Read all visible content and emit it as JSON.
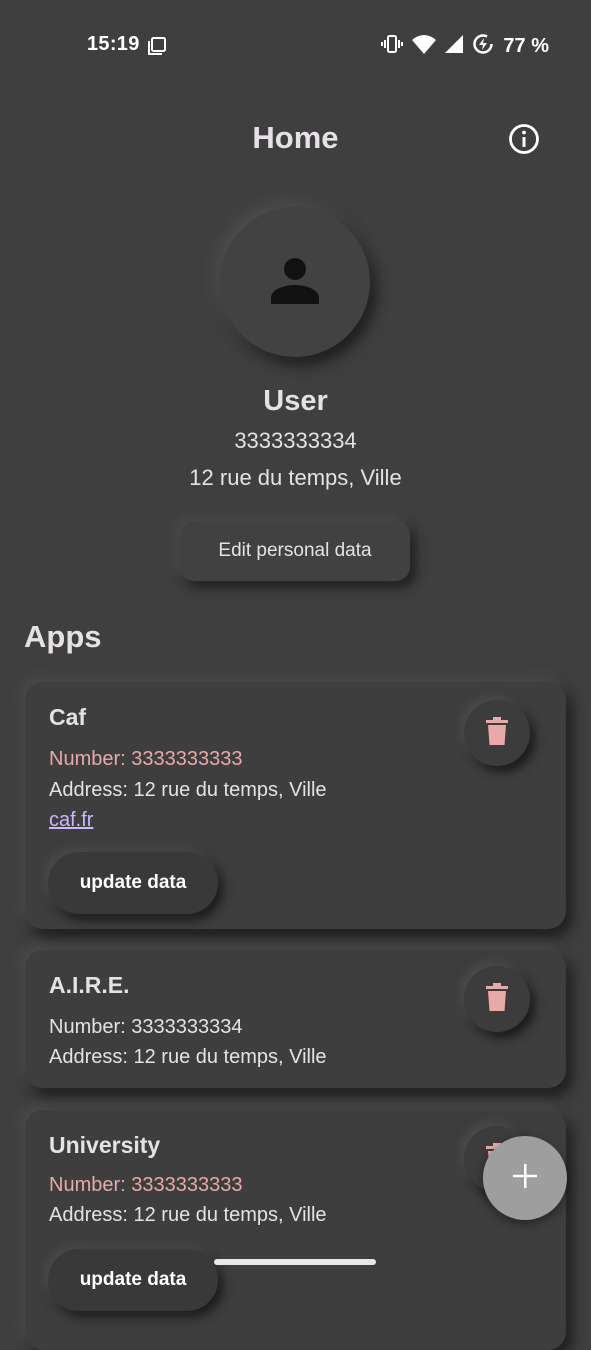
{
  "status_bar": {
    "time": "15:19",
    "battery_percent": "77 %",
    "icons": [
      "screenshot-icon",
      "vibrate-icon",
      "wifi-icon",
      "signal-icon",
      "battery-saver-icon"
    ]
  },
  "app_bar": {
    "title": "Home",
    "info_icon": "info-icon"
  },
  "profile": {
    "avatar_icon": "person-icon",
    "name": "User",
    "number": "3333333334",
    "address": "12 rue du temps, Ville",
    "edit_label": "Edit personal data"
  },
  "apps_section": {
    "title": "Apps",
    "cards": [
      {
        "title": "Caf",
        "number": "Number: 3333333333",
        "address": "Address: 12 rue du temps, Ville",
        "link": "caf.fr",
        "update_label": "update data"
      },
      {
        "title": "A.I.R.E.",
        "number": "Number: 3333333334",
        "address": "Address: 12 rue du temps, Ville"
      },
      {
        "title": "University",
        "number": "Number: 3333333333",
        "address": "Address: 12 rue du temps, Ville",
        "update_label": "update data"
      }
    ]
  },
  "fab": {
    "icon": "plus-icon"
  },
  "colors": {
    "background": "#3f3f3f",
    "text": "#e6e1e6",
    "highlight_number": "#e8a9a9",
    "link": "#c9b7ff",
    "trash_icon": "#e8a9a9",
    "fab": "#9e9e9e"
  }
}
